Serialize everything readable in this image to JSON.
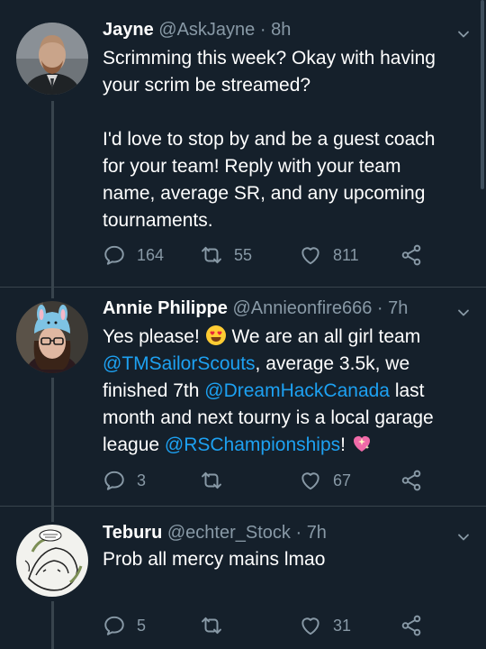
{
  "tweets": [
    {
      "name": "Jayne",
      "handle": "@AskJayne",
      "time": "8h",
      "text_lines": [
        "Scrimming this week? Okay with having",
        "your scrim be streamed?",
        "",
        "I'd love to stop by and be a guest coach",
        "for your team! Reply with your team",
        "name, average SR, and any upcoming",
        "tournaments."
      ],
      "replies": "164",
      "retweets": "55",
      "likes": "811"
    },
    {
      "name": "Annie Philippe",
      "handle": "@Annieonfire666",
      "time": "7h",
      "text_parts": {
        "l1_a": "Yes please! ",
        "l1_b": " We are an all girl team",
        "mention1": "@TMSailorScouts",
        "l2_b": ", average 3.5k, we",
        "l3_a": "finished 7th ",
        "mention2": "@DreamHackCanada",
        "l3_b": " last",
        "l4": "month and next tourny is a local garage",
        "l5_a": "league ",
        "mention3": "@RSChampionships",
        "l5_b": "! "
      },
      "replies": "3",
      "retweets": "",
      "likes": "67"
    },
    {
      "name": "Teburu",
      "handle": "@echter_Stock",
      "time": "7h",
      "text": "Prob all mercy mains lmao",
      "replies": "5",
      "retweets": "",
      "likes": "31"
    }
  ],
  "separator": "·",
  "colors": {
    "background": "#15202b",
    "muted": "#8899a6",
    "link": "#1da1f2",
    "divider": "#38444d"
  },
  "icons": [
    "reply-icon",
    "retweet-icon",
    "like-icon",
    "share-icon",
    "chevron-down-icon",
    "smiling-face-heart-eyes-emoji",
    "sparkling-heart-emoji"
  ]
}
